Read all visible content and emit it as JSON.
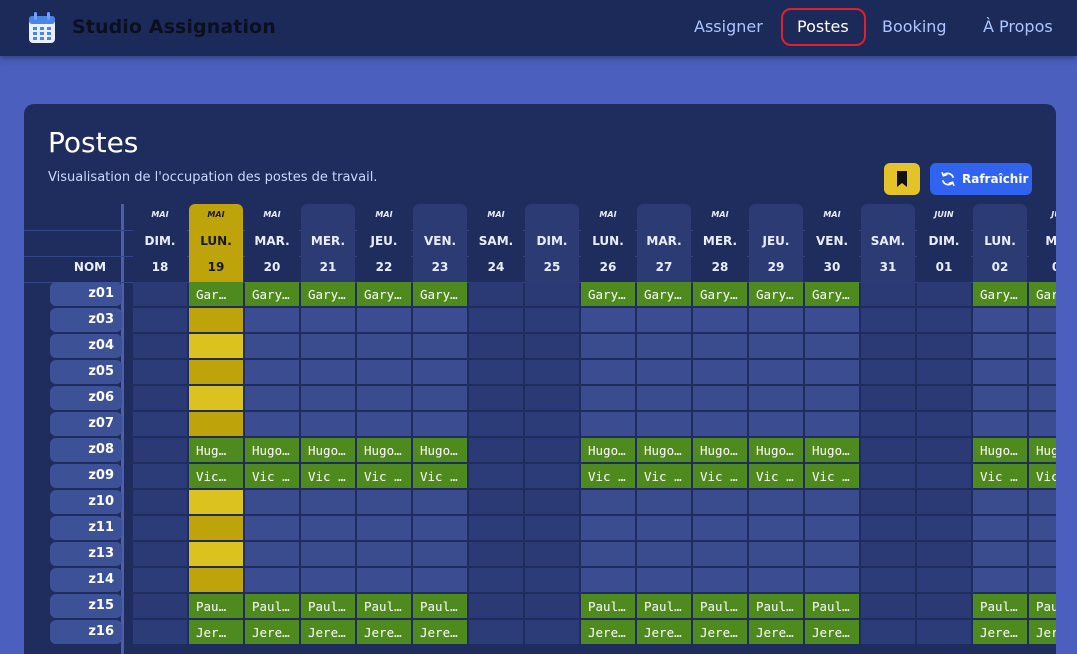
{
  "header": {
    "title": "Studio Assignation",
    "nav": [
      "Assigner",
      "Postes",
      "Booking",
      "À Propos"
    ],
    "active_nav": "Postes"
  },
  "card": {
    "title": "Postes",
    "subtitle": "Visualisation de l'occupation des postes de travail.",
    "refresh_label": "Rafraîchir"
  },
  "table": {
    "name_header": "NOM",
    "columns": [
      {
        "month": "MAI",
        "day": "DIM.",
        "date": "18",
        "weekend": true
      },
      {
        "month": "MAI",
        "day": "LUN.",
        "date": "19",
        "today": true
      },
      {
        "month": "MAI",
        "day": "MAR.",
        "date": "20"
      },
      {
        "month": "",
        "day": "MER.",
        "date": "21"
      },
      {
        "month": "MAI",
        "day": "JEU.",
        "date": "22"
      },
      {
        "month": "",
        "day": "VEN.",
        "date": "23"
      },
      {
        "month": "MAI",
        "day": "SAM.",
        "date": "24",
        "weekend": true
      },
      {
        "month": "",
        "day": "DIM.",
        "date": "25",
        "weekend": true
      },
      {
        "month": "MAI",
        "day": "LUN.",
        "date": "26"
      },
      {
        "month": "",
        "day": "MAR.",
        "date": "27"
      },
      {
        "month": "MAI",
        "day": "MER.",
        "date": "28"
      },
      {
        "month": "",
        "day": "JEU.",
        "date": "29"
      },
      {
        "month": "MAI",
        "day": "VEN.",
        "date": "30"
      },
      {
        "month": "",
        "day": "SAM.",
        "date": "31",
        "weekend": true
      },
      {
        "month": "JUIN",
        "day": "DIM.",
        "date": "01",
        "weekend": true
      },
      {
        "month": "",
        "day": "LUN.",
        "date": "02"
      },
      {
        "month": "JU",
        "day": "MA",
        "date": "0"
      }
    ],
    "rows": [
      {
        "name": "z01",
        "cells": [
          "",
          "Gar…",
          "Gary…",
          "Gary…",
          "Gary…",
          "Gary…",
          "",
          "",
          "Gary…",
          "Gary…",
          "Gary…",
          "Gary…",
          "Gary…",
          "",
          "",
          "Gary…",
          "Gar"
        ]
      },
      {
        "name": "z03",
        "cells": [
          "",
          "",
          "",
          "",
          "",
          "",
          "",
          "",
          "",
          "",
          "",
          "",
          "",
          "",
          "",
          "",
          ""
        ]
      },
      {
        "name": "z04",
        "cells": [
          "",
          "",
          "",
          "",
          "",
          "",
          "",
          "",
          "",
          "",
          "",
          "",
          "",
          "",
          "",
          "",
          ""
        ]
      },
      {
        "name": "z05",
        "cells": [
          "",
          "",
          "",
          "",
          "",
          "",
          "",
          "",
          "",
          "",
          "",
          "",
          "",
          "",
          "",
          "",
          ""
        ]
      },
      {
        "name": "z06",
        "cells": [
          "",
          "",
          "",
          "",
          "",
          "",
          "",
          "",
          "",
          "",
          "",
          "",
          "",
          "",
          "",
          "",
          ""
        ]
      },
      {
        "name": "z07",
        "cells": [
          "",
          "",
          "",
          "",
          "",
          "",
          "",
          "",
          "",
          "",
          "",
          "",
          "",
          "",
          "",
          "",
          ""
        ]
      },
      {
        "name": "z08",
        "cells": [
          "",
          "Hug…",
          "Hugo…",
          "Hugo…",
          "Hugo…",
          "Hugo…",
          "",
          "",
          "Hugo…",
          "Hugo…",
          "Hugo…",
          "Hugo…",
          "Hugo…",
          "",
          "",
          "Hugo…",
          "Hug"
        ]
      },
      {
        "name": "z09",
        "cells": [
          "",
          "Vic…",
          "Vic …",
          "Vic …",
          "Vic …",
          "Vic …",
          "",
          "",
          "Vic …",
          "Vic …",
          "Vic …",
          "Vic …",
          "Vic …",
          "",
          "",
          "Vic …",
          "Vic"
        ]
      },
      {
        "name": "z10",
        "cells": [
          "",
          "",
          "",
          "",
          "",
          "",
          "",
          "",
          "",
          "",
          "",
          "",
          "",
          "",
          "",
          "",
          ""
        ]
      },
      {
        "name": "z11",
        "cells": [
          "",
          "",
          "",
          "",
          "",
          "",
          "",
          "",
          "",
          "",
          "",
          "",
          "",
          "",
          "",
          "",
          ""
        ]
      },
      {
        "name": "z13",
        "cells": [
          "",
          "",
          "",
          "",
          "",
          "",
          "",
          "",
          "",
          "",
          "",
          "",
          "",
          "",
          "",
          "",
          ""
        ]
      },
      {
        "name": "z14",
        "cells": [
          "",
          "",
          "",
          "",
          "",
          "",
          "",
          "",
          "",
          "",
          "",
          "",
          "",
          "",
          "",
          "",
          ""
        ]
      },
      {
        "name": "z15",
        "cells": [
          "",
          "Pau…",
          "Paul…",
          "Paul…",
          "Paul…",
          "Paul…",
          "",
          "",
          "Paul…",
          "Paul…",
          "Paul…",
          "Paul…",
          "Paul…",
          "",
          "",
          "Paul…",
          "Pau"
        ]
      },
      {
        "name": "z16",
        "cells": [
          "",
          "Jer…",
          "Jere…",
          "Jere…",
          "Jere…",
          "Jere…",
          "",
          "",
          "Jere…",
          "Jere…",
          "Jere…",
          "Jere…",
          "Jere…",
          "",
          "",
          "Jere…",
          "Jer"
        ]
      }
    ]
  },
  "colors": {
    "assigned": "#4f8a1e",
    "today_dark": "#bfa30a",
    "today_light": "#dcc21e",
    "weekday_cell": "#3b4d90",
    "weekend_cell": "#2c3c78",
    "accent": "#2f63f0"
  }
}
